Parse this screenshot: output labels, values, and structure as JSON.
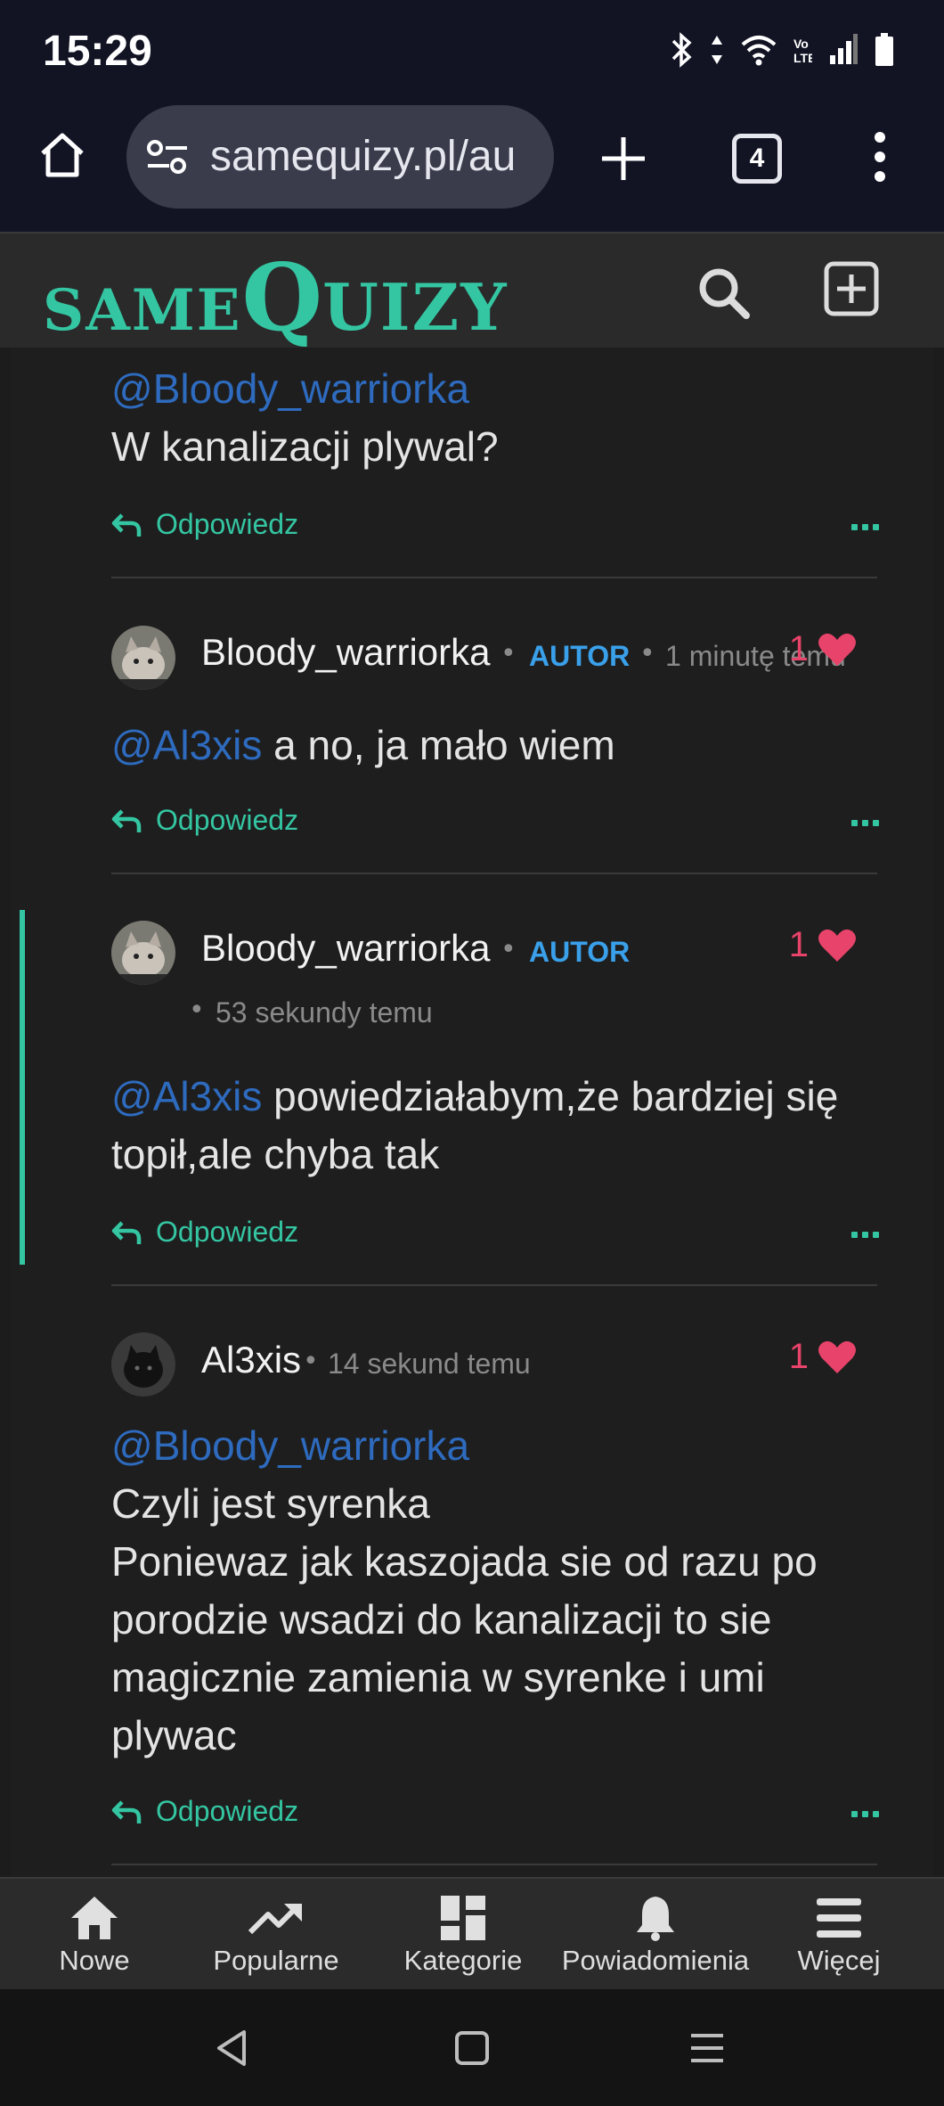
{
  "status": {
    "time": "15:29"
  },
  "browser": {
    "url": "samequizy.pl/au",
    "tab_count": "4"
  },
  "site": {
    "logo_same": "SAME",
    "logo_q": "Q",
    "logo_uizy": "UIZY"
  },
  "comments": [
    {
      "mention": "@Bloody_warriorka",
      "text": "W kanalizacji plywal?",
      "reply": "Odpowiedz"
    },
    {
      "author": "Bloody_warriorka",
      "badge": "AUTOR",
      "time": "1 minutę temu",
      "likes": "1",
      "mention": "@Al3xis",
      "text": " a no, ja mało wiem",
      "reply": "Odpowiedz"
    },
    {
      "author": "Bloody_warriorka",
      "badge": "AUTOR",
      "time": "53 sekundy temu",
      "likes": "1",
      "mention": "@Al3xis",
      "text": " powiedziałabym,że bardziej się topił,ale chyba tak",
      "reply": "Odpowiedz"
    },
    {
      "author": "Al3xis",
      "time": "14 sekund temu",
      "likes": "1",
      "mention": "@Bloody_warriorka",
      "line1": "Czyli jest syrenka",
      "line2": "Poniewaz jak kaszojada sie od razu po porodzie wsadzi do kanalizacji to sie magicznie zamienia w syrenke i umi plywac",
      "reply": "Odpowiedz"
    }
  ],
  "bottom_nav": [
    {
      "label": "Nowe",
      "icon": "home-icon"
    },
    {
      "label": "Popularne",
      "icon": "trending-icon"
    },
    {
      "label": "Kategorie",
      "icon": "dashboard-icon"
    },
    {
      "label": "Powiadomienia",
      "icon": "bell-icon"
    },
    {
      "label": "Więcej",
      "icon": "menu-icon"
    }
  ],
  "colors": {
    "accent": "#34c6a2",
    "mention": "#2e6bbf",
    "badge": "#3aa0ea",
    "like": "#e8436a"
  }
}
